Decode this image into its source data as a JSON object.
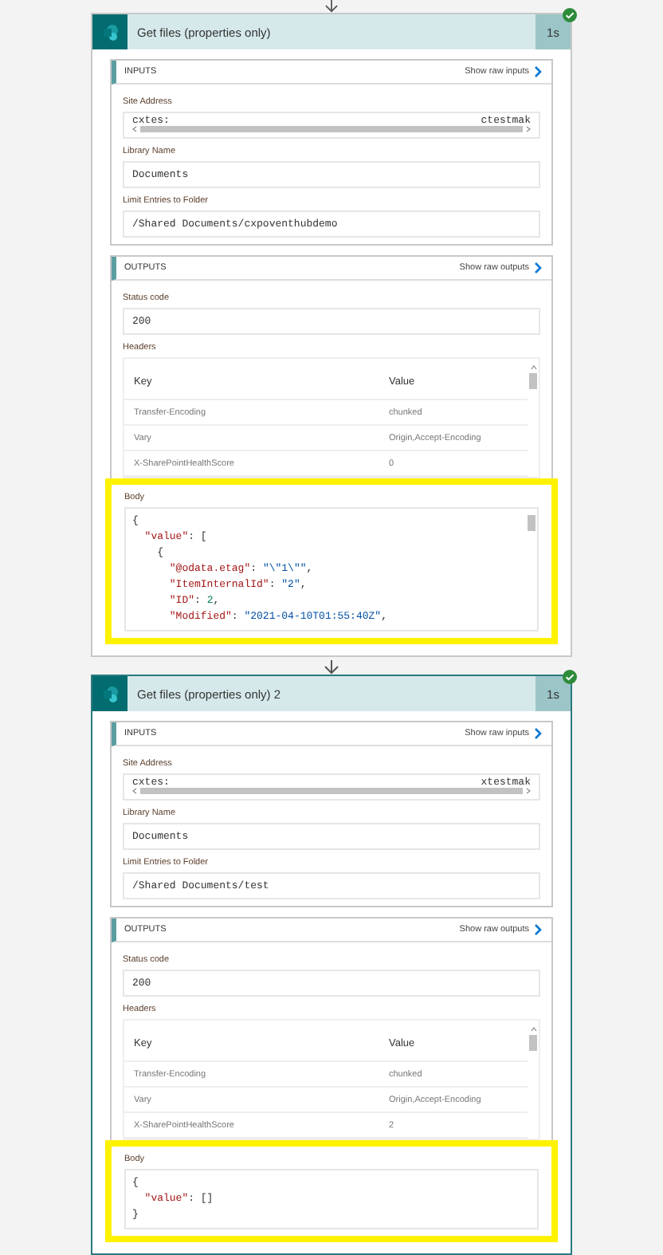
{
  "actions": [
    {
      "title": "Get files (properties only)",
      "duration": "1s",
      "succeeded": true,
      "selected": false,
      "inputs": {
        "heading": "INPUTS",
        "link": "Show raw inputs",
        "fields": [
          {
            "kind": "scroll",
            "label": "Site Address",
            "value_start": "cxtes:",
            "value_end": "ctestmak"
          },
          {
            "kind": "text",
            "label": "Library Name",
            "value": "Documents"
          },
          {
            "kind": "text",
            "label": "Limit Entries to Folder",
            "value": "/Shared Documents/cxpoventhubdemo"
          }
        ]
      },
      "outputs": {
        "heading": "OUTPUTS",
        "link": "Show raw outputs",
        "status_label": "Status code",
        "status": "200",
        "headers_label": "Headers",
        "columns": [
          "Key",
          "Value"
        ],
        "rows": [
          [
            "Transfer-Encoding",
            "chunked"
          ],
          [
            "Vary",
            "Origin,Accept-Encoding"
          ],
          [
            "X-SharePointHealthScore",
            "0"
          ]
        ],
        "body_label": "Body",
        "highlighted": true,
        "body_scroll": true,
        "body": [
          [
            {
              "kind": "punct",
              "text": "{"
            }
          ],
          [
            {
              "kind": "key",
              "text": "  \"value\""
            },
            {
              "kind": "punct",
              "text": ": ["
            }
          ],
          [
            {
              "kind": "punct",
              "text": "    {"
            }
          ],
          [
            {
              "kind": "key",
              "text": "      \"@odata.etag\""
            },
            {
              "kind": "punct",
              "text": ": "
            },
            {
              "kind": "string",
              "text": "\"\\\"1\\\"\""
            },
            {
              "kind": "punct",
              "text": ","
            }
          ],
          [
            {
              "kind": "key",
              "text": "      \"ItemInternalId\""
            },
            {
              "kind": "punct",
              "text": ": "
            },
            {
              "kind": "string",
              "text": "\"2\""
            },
            {
              "kind": "punct",
              "text": ","
            }
          ],
          [
            {
              "kind": "key",
              "text": "      \"ID\""
            },
            {
              "kind": "punct",
              "text": ": "
            },
            {
              "kind": "number",
              "text": "2"
            },
            {
              "kind": "punct",
              "text": ","
            }
          ],
          [
            {
              "kind": "key",
              "text": "      \"Modified\""
            },
            {
              "kind": "punct",
              "text": ": "
            },
            {
              "kind": "string",
              "text": "\"2021-04-10T01:55:40Z\""
            },
            {
              "kind": "punct",
              "text": ","
            }
          ]
        ]
      }
    },
    {
      "title": "Get files (properties only) 2",
      "duration": "1s",
      "succeeded": true,
      "selected": true,
      "inputs": {
        "heading": "INPUTS",
        "link": "Show raw inputs",
        "fields": [
          {
            "kind": "scroll",
            "label": "Site Address",
            "value_start": "cxtes:",
            "value_end": "xtestmak"
          },
          {
            "kind": "text",
            "label": "Library Name",
            "value": "Documents"
          },
          {
            "kind": "text",
            "label": "Limit Entries to Folder",
            "value": "/Shared Documents/test"
          }
        ]
      },
      "outputs": {
        "heading": "OUTPUTS",
        "link": "Show raw outputs",
        "status_label": "Status code",
        "status": "200",
        "headers_label": "Headers",
        "columns": [
          "Key",
          "Value"
        ],
        "rows": [
          [
            "Transfer-Encoding",
            "chunked"
          ],
          [
            "Vary",
            "Origin,Accept-Encoding"
          ],
          [
            "X-SharePointHealthScore",
            "2"
          ]
        ],
        "body_label": "Body",
        "highlighted": true,
        "body_scroll": false,
        "body": [
          [
            {
              "kind": "punct",
              "text": "{"
            }
          ],
          [
            {
              "kind": "key",
              "text": "  \"value\""
            },
            {
              "kind": "punct",
              "text": ": []"
            }
          ],
          [
            {
              "kind": "punct",
              "text": "}"
            }
          ]
        ]
      }
    }
  ]
}
